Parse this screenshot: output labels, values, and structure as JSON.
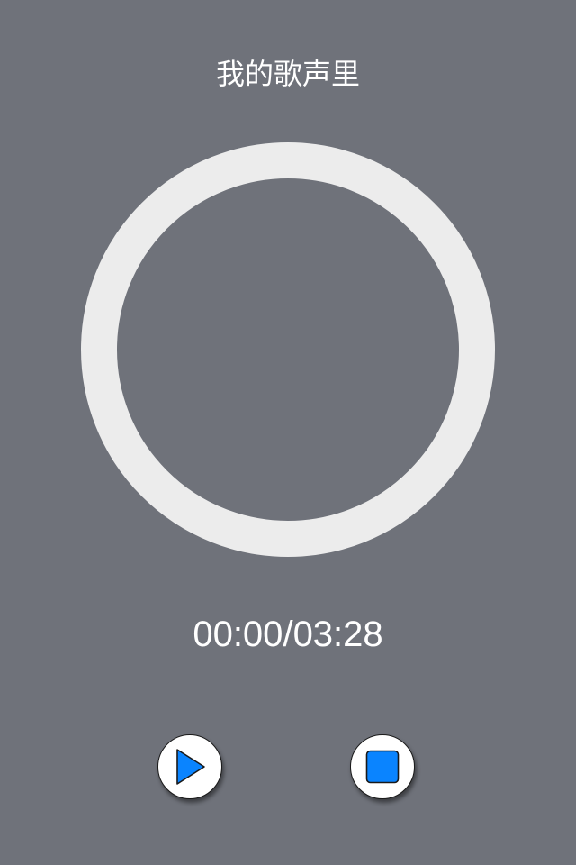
{
  "song": {
    "title": "我的歌声里"
  },
  "playback": {
    "elapsed": "00:00",
    "separator": "/",
    "duration": "03:28",
    "progress_fraction": 0
  },
  "controls": {
    "play_icon": "play-icon",
    "stop_icon": "stop-icon"
  },
  "colors": {
    "background": "#6f727a",
    "ring": "#ececec",
    "accent": "#0a84ff",
    "text": "#ffffff"
  }
}
